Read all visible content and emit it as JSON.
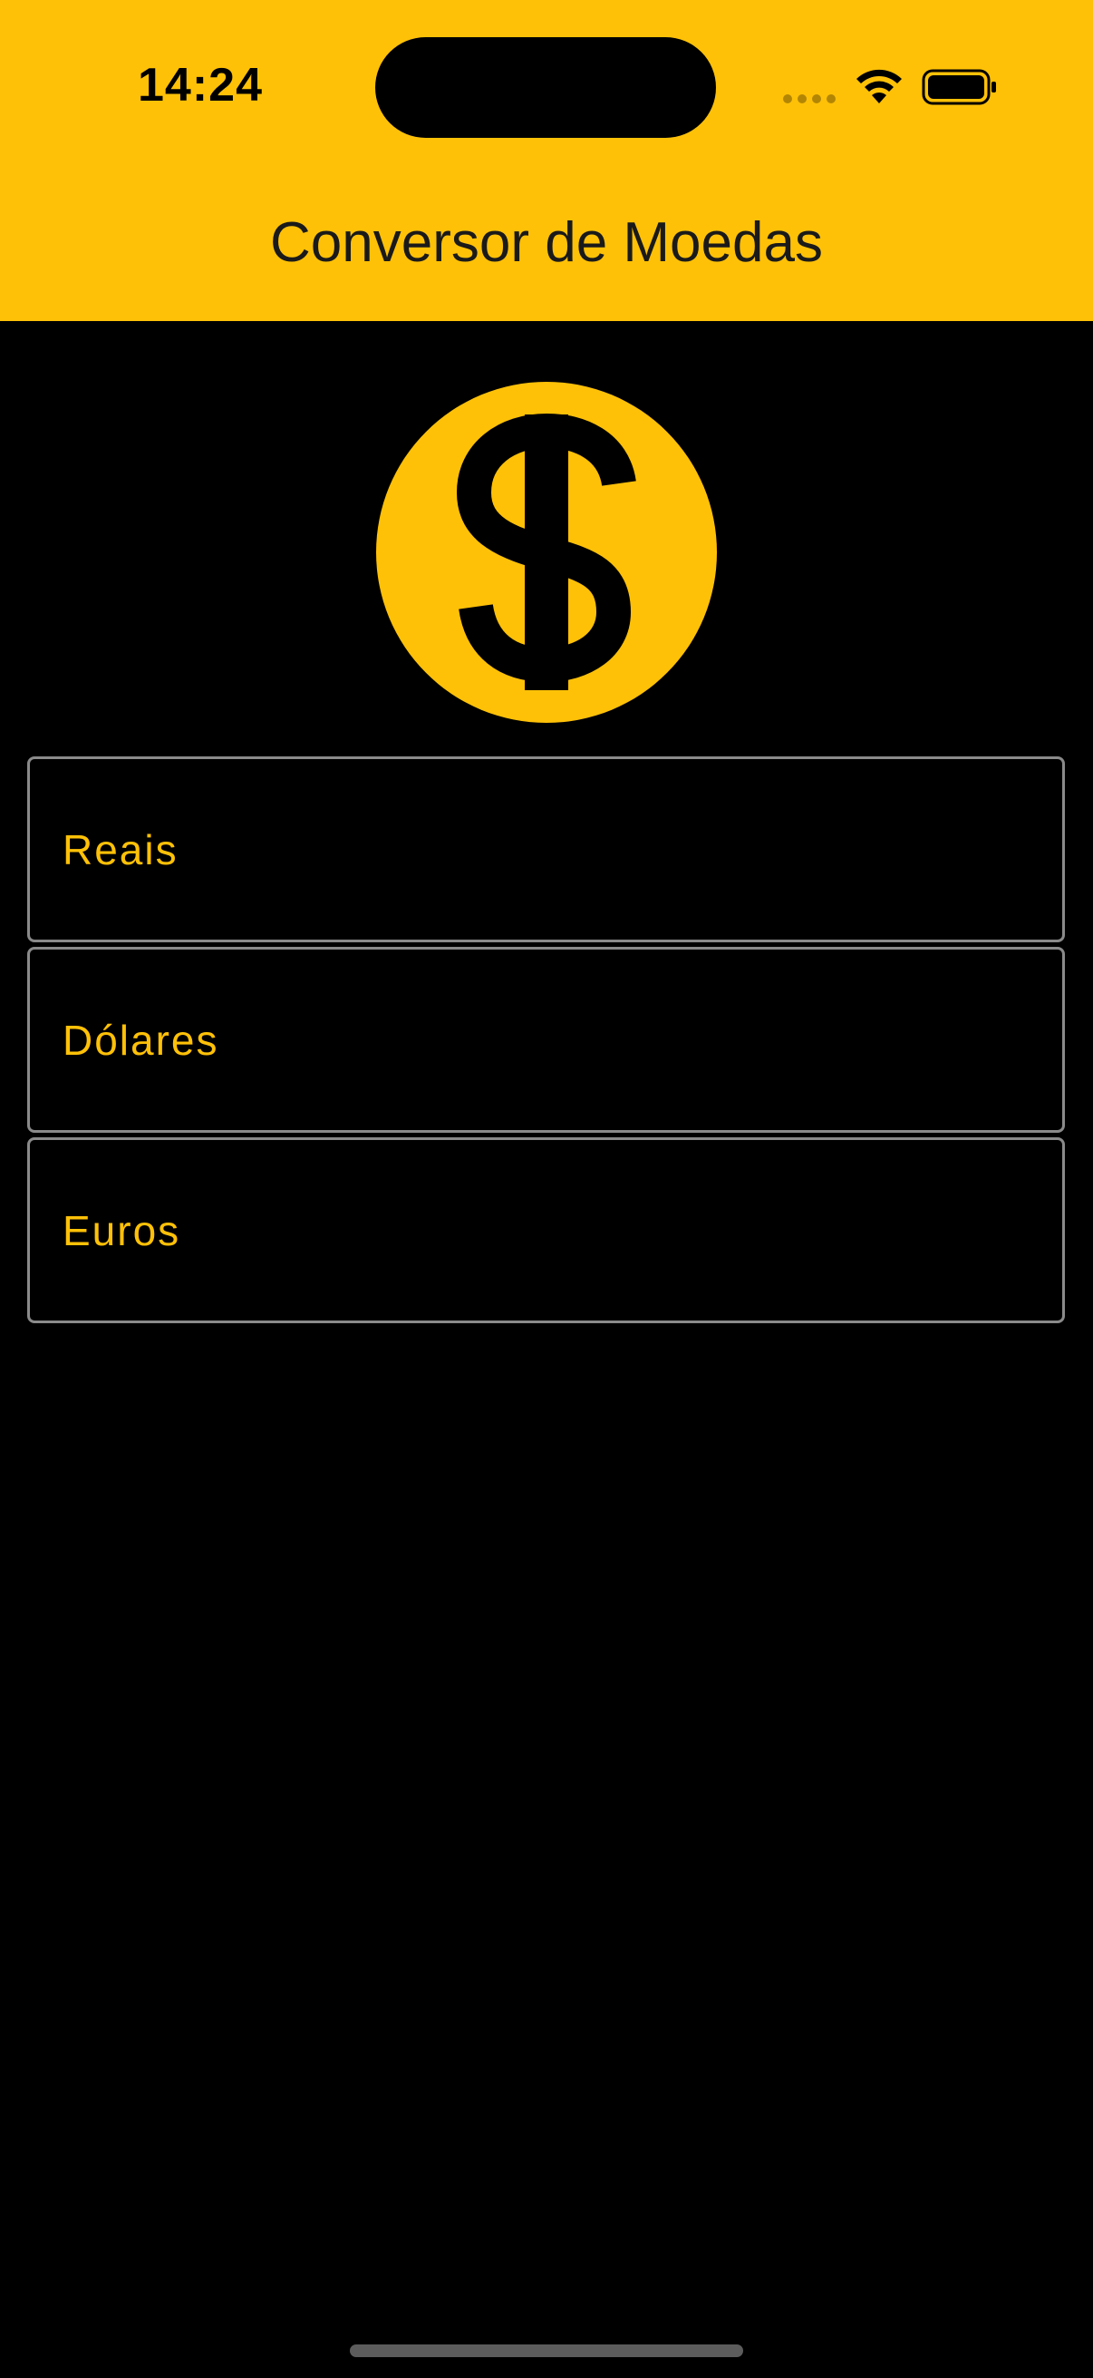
{
  "status_bar": {
    "time": "14:24"
  },
  "header": {
    "title": "Conversor de Moedas"
  },
  "coin": {
    "icon": "dollar-sign-icon"
  },
  "fields": [
    {
      "label": "Reais"
    },
    {
      "label": "Dólares"
    },
    {
      "label": "Euros"
    }
  ],
  "colors": {
    "accent": "#FFC107",
    "background": "#000000",
    "field_border": "#8a8a8a"
  }
}
